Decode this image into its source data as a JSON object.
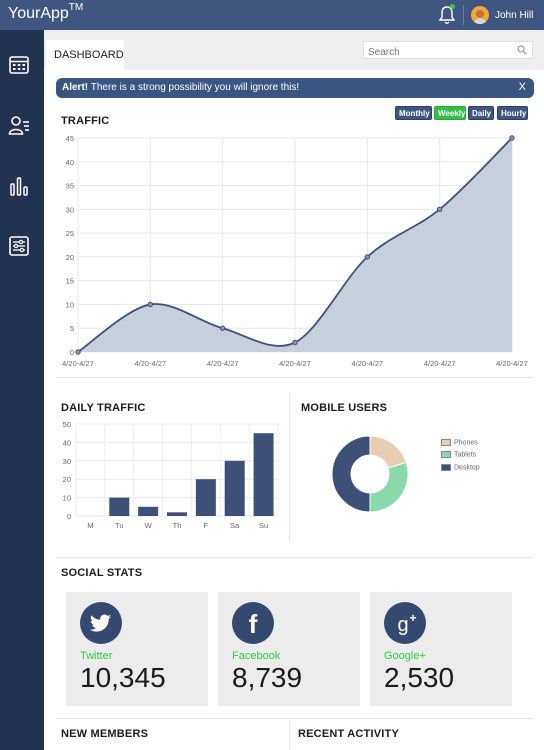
{
  "header": {
    "brand": "YourApp",
    "brand_tm": "TM",
    "user_name": "John Hill"
  },
  "sidebar": {
    "items": [
      {
        "icon": "calendar-icon"
      },
      {
        "icon": "user-list-icon"
      },
      {
        "icon": "bar-chart-icon"
      },
      {
        "icon": "sliders-icon"
      }
    ]
  },
  "tabs": {
    "dashboard": "DASHBOARD"
  },
  "search": {
    "placeholder": "Search"
  },
  "alert": {
    "strong": "Alert!",
    "message": " There is a strong possibility you will ignore this!",
    "close": "X"
  },
  "traffic": {
    "title": "TRAFFIC",
    "periods": [
      "Monthly",
      "Weekly",
      "Daily",
      "Hourly"
    ],
    "active_period": "Weekly"
  },
  "daily_traffic": {
    "title": "DAILY TRAFFIC"
  },
  "mobile_users": {
    "title": "MOBILE USERS"
  },
  "social": {
    "title": "SOCIAL STATS",
    "cards": [
      {
        "name": "Twitter",
        "value": "10,345",
        "icon": "twitter-icon"
      },
      {
        "name": "Facebook",
        "value": "8,739",
        "icon": "facebook-icon"
      },
      {
        "name": "Google+",
        "value": "2,530",
        "icon": "google-plus-icon"
      }
    ]
  },
  "bottom": {
    "new_members": "NEW MEMBERS",
    "recent_activity": "RECENT ACTIVITY"
  },
  "colors": {
    "header": "#3f5681",
    "sidebar": "#223352",
    "accent_green": "#2ecc40",
    "series_navy": "#3d5078",
    "area_fill": "#c8cfdc"
  },
  "chart_data": [
    {
      "type": "area",
      "x": [
        "4/20-4/27",
        "4/20-4/27",
        "4/20-4/27",
        "4/20-4/27",
        "4/20-4/27",
        "4/20-4/27",
        "4/20-4/27"
      ],
      "values": [
        0,
        10,
        5,
        2,
        20,
        30,
        45
      ],
      "ylim": [
        0,
        45
      ],
      "yticks": [
        0,
        5,
        10,
        15,
        20,
        25,
        30,
        35,
        40,
        45
      ],
      "grid": true
    },
    {
      "type": "bar",
      "categories": [
        "M",
        "Tu",
        "W",
        "Th",
        "F",
        "Sa",
        "Su"
      ],
      "values": [
        0,
        10,
        5,
        2,
        20,
        30,
        45
      ],
      "ylim": [
        0,
        50
      ],
      "yticks": [
        0,
        10,
        20,
        30,
        40,
        50
      ],
      "grid": true
    },
    {
      "type": "pie",
      "labels": [
        "Phones",
        "Tablets",
        "Desktop"
      ],
      "values": [
        20,
        30,
        50
      ],
      "colors": [
        "#e8cdb4",
        "#8ad9aa",
        "#3d5078"
      ],
      "legend": "right"
    }
  ]
}
